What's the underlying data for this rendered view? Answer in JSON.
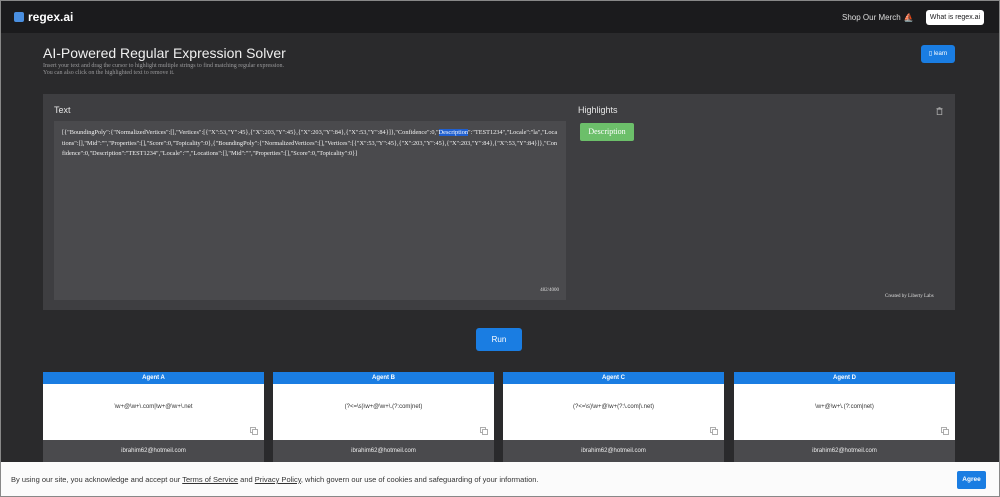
{
  "header": {
    "logo_text": "regex.ai",
    "merch_label": "Shop Our Merch",
    "whatis_label": "What is regex.ai"
  },
  "page": {
    "title": "AI-Powered Regular Expression Solver",
    "subtitle_line1": "Insert your text and drag the cursor to highlight multiple strings to find matching regular expression.",
    "subtitle_line2": "You can also click on the highlighted text to remove it.",
    "learn_label": "learn"
  },
  "text_panel": {
    "label": "Text",
    "content_before": "[{\"BoundingPoly\":{\"NormalizedVertices\":[],\"Vertices\":[{\"X\":53,\"Y\":45},{\"X\":203,\"Y\":45},{\"X\":203,\"Y\":84},{\"X\":53,\"Y\":84}]},\"Confidence\":0,\"",
    "content_highlight": "Description",
    "content_after": "\":\"TEST1234\",\"Locale\":\"la\",\"Locations\":[],\"Mid\":\"\",\"Properties\":[],\"Score\":0,\"Topicality\":0},{\"BoundingPoly\":{\"NormalizedVertices\":[],\"Vertices\":[{\"X\":53,\"Y\":45},{\"X\":203,\"Y\":45},{\"X\":203,\"Y\":84},{\"X\":53,\"Y\":84}]},\"Confidence\":0,\"Description\":\"TEST1234\",\"Locale\":\"\",\"Locations\":[],\"Mid\":\"\",\"Properties\":[],\"Score\":0,\"Topicality\":0}]",
    "char_count": "482/4000"
  },
  "highlights_panel": {
    "label": "Highlights",
    "chips": [
      "Description"
    ],
    "credit": "Created by Liberty Labs"
  },
  "run_label": "Run",
  "agents": [
    {
      "name": "Agent A",
      "regex": "\\w+@\\w+\\.com|\\w+@\\w+\\.net",
      "result": "ibrahim62@hotmeil.com"
    },
    {
      "name": "Agent B",
      "regex": "(?<=\\s)\\w+@\\w+\\.(?:com|net)",
      "result": "ibrahim62@hotmeil.com"
    },
    {
      "name": "Agent C",
      "regex": "(?<=\\s)\\w+@\\w+(?:\\.com|\\.net)",
      "result": "ibrahim62@hotmeil.com"
    },
    {
      "name": "Agent D",
      "regex": "\\w+@\\w+\\.(?:com|net)",
      "result": "ibrahim62@hotmeil.com"
    }
  ],
  "cookie": {
    "text_prefix": "By using our site, you acknowledge and accept our ",
    "terms_link": "Terms of Service",
    "text_and": " and ",
    "privacy_link": "Privacy Policy",
    "text_suffix": ", which govern our use of cookies and safeguarding of your information.",
    "agree_label": "Agree"
  },
  "colors": {
    "accent": "#1a7de2",
    "highlight_chip": "#6cbf6a",
    "topbar": "#1b1b1d"
  }
}
